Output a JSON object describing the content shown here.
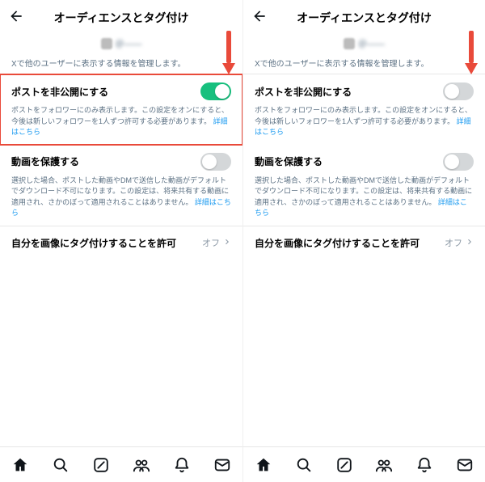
{
  "header": {
    "title": "オーディエンスとタグ付け",
    "subtitle_user": "＠——"
  },
  "page_desc": "Xで他のユーザーに表示する情報を管理します。",
  "sections": {
    "protect_posts": {
      "title": "ポストを非公開にする",
      "desc_pre": "ポストをフォロワーにのみ表示します。この設定をオンにすると、今後は新しいフォロワーを1人ずつ許可する必要があります。",
      "link": "詳細はこちら"
    },
    "protect_video": {
      "title": "動画を保護する",
      "desc_pre": "選択した場合、ポストした動画やDMで送信した動画がデフォルトでダウンロード不可になります。この設定は、将来共有する動画に適用され、さかのぼって適用されることはありません。",
      "link": "詳細はこちら"
    },
    "tagging": {
      "title": "自分を画像にタグ付けすることを許可",
      "value": "オフ"
    }
  },
  "left_pane": {
    "protect_posts_on": true
  },
  "right_pane": {
    "protect_posts_on": false
  }
}
